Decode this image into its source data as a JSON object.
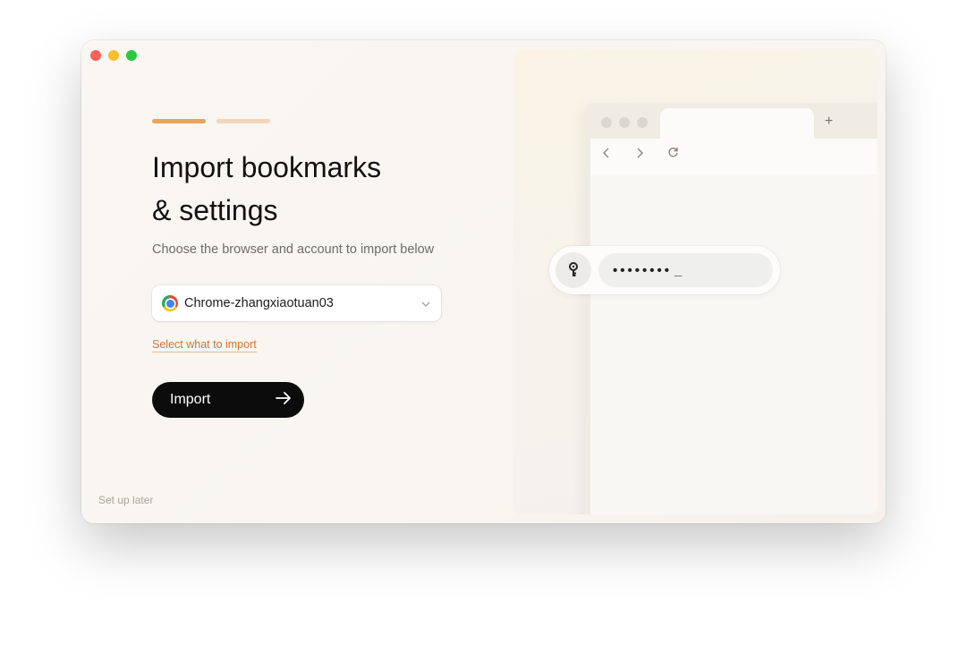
{
  "window": {
    "controls": [
      "close",
      "minimize",
      "maximize"
    ]
  },
  "progress": {
    "current_step": 1,
    "total_steps": 2
  },
  "heading": {
    "line1": "Import bookmarks",
    "line2": "& settings",
    "subtitle": "Choose the browser and account to import below"
  },
  "browser_select": {
    "icon": "chrome-icon",
    "value": "Chrome-zhangxiaotuan03"
  },
  "links": {
    "select_what": "Select what to import",
    "setup_later": "Set up later"
  },
  "import_button": {
    "label": "Import",
    "icon": "arrow-right-icon"
  },
  "illustration": {
    "new_tab_symbol": "+",
    "password_mask": "••••••••",
    "cursor": "_"
  },
  "colors": {
    "accent": "#eba35c",
    "accent_light": "#f3d6b9",
    "link": "#d2742d",
    "button": "#0c0c0c"
  }
}
